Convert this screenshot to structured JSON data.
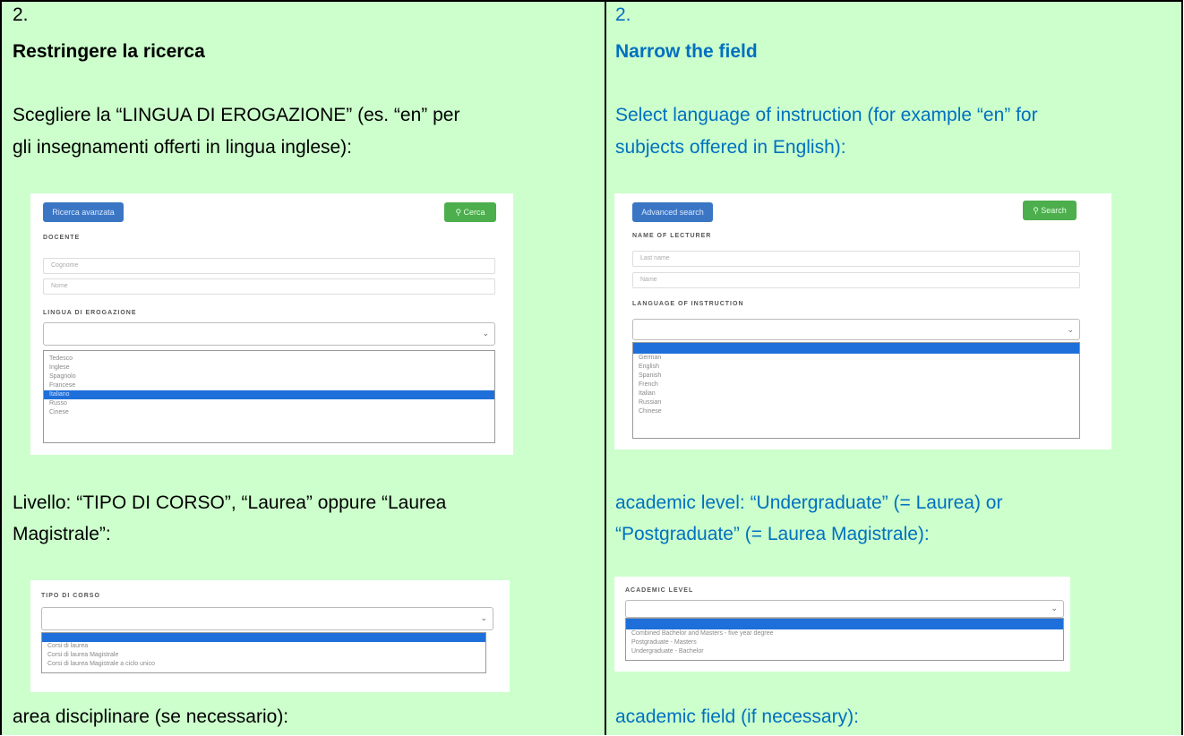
{
  "left": {
    "number": "2.",
    "heading": "Restringere la ricerca",
    "para1_line1": "Scegliere la “LINGUA DI EROGAZIONE” (es. “en” per",
    "para1_line2": "gli insegnamenti offerti in lingua inglese):",
    "para2_line1": "Livello: “TIPO DI CORSO”, “Laurea” oppure “Laurea",
    "para2_line2": "Magistrale”:",
    "para3": "area disciplinare (se necessario):",
    "shot1": {
      "button": "Ricerca avanzata",
      "search_button": "Cerca",
      "docente_label": "DOCENTE",
      "surname_placeholder": "Cognome",
      "name_placeholder": "Nome",
      "lingua_label": "LINGUA DI EROGAZIONE",
      "options": [
        "",
        "Tedesco",
        "Inglese",
        "Spagnolo",
        "Francese",
        "Italiano",
        "Russo",
        "Cinese"
      ]
    },
    "shot2": {
      "label": "TIPO DI CORSO",
      "options": [
        "",
        "Corsi di laurea",
        "Corsi di laurea Magistrale",
        "Corsi di laurea Magistrale a ciclo unico"
      ]
    }
  },
  "right": {
    "number": "2.",
    "heading": "Narrow the field",
    "para1_line1": "Select language of instruction (for example “en” for",
    "para1_line2": "subjects offered in English):",
    "para2_line1": "academic level: “Undergraduate” (= Laurea) or",
    "para2_line2": "“Postgraduate” (= Laurea Magistrale):",
    "para3": "academic field (if necessary):",
    "shot1": {
      "button": "Advanced search",
      "search_button": "Search",
      "lecturer_label": "NAME OF LECTURER",
      "lastname_placeholder": "Last name",
      "name_placeholder": "Name",
      "language_label": "LANGUAGE OF INSTRUCTION",
      "options": [
        "",
        "German",
        "English",
        "Spanish",
        "French",
        "Italian",
        "Russian",
        "Chinese"
      ]
    },
    "shot2": {
      "label": "ACADEMIC LEVEL",
      "options": [
        "",
        "Combined Bachelor and Masters - five year degree",
        "Postgraduate - Masters",
        "Undergraduate - Bachelor"
      ]
    }
  },
  "colors": {
    "background": "#ccffcc",
    "right_text": "#0070c0",
    "select_highlight": "#1e6fd9",
    "button_blue": "#3a76c4",
    "button_green": "#4cae4c"
  }
}
